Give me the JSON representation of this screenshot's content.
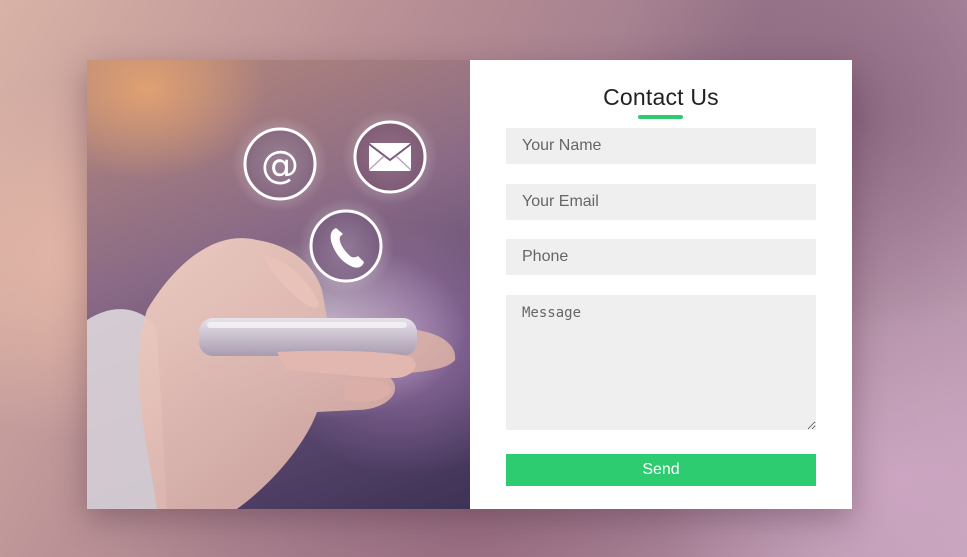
{
  "form": {
    "title": "Contact Us",
    "name_placeholder": "Your Name",
    "email_placeholder": "Your Email",
    "phone_placeholder": "Phone",
    "message_placeholder": "Message",
    "send_label": "Send"
  },
  "hero": {
    "icons": [
      "at-sign-icon",
      "envelope-icon",
      "phone-icon"
    ]
  },
  "colors": {
    "accent": "#2ecc71",
    "field_bg": "#efefef",
    "panel_bg": "#ffffff"
  }
}
